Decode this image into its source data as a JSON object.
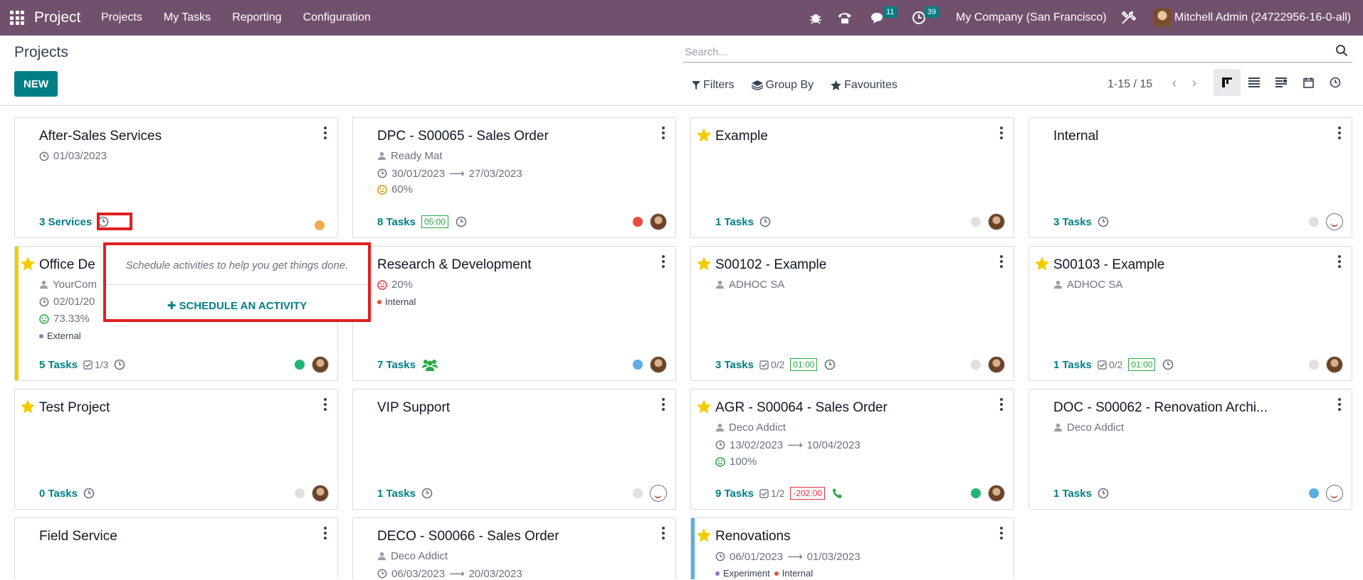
{
  "app": {
    "title": "Project"
  },
  "topnav": [
    "Projects",
    "My Tasks",
    "Reporting",
    "Configuration"
  ],
  "systray": {
    "messages_badge": "11",
    "activities_badge": "39",
    "company": "My Company (San Francisco)",
    "user": "Mitchell Admin (24722956-16-0-all)"
  },
  "control": {
    "title": "Projects",
    "new_label": "NEW",
    "search_placeholder": "Search...",
    "filters_label": "Filters",
    "groupby_label": "Group By",
    "favourites_label": "Favourites",
    "pager": "1-15 / 15"
  },
  "colors": {
    "topbar": "#71506d",
    "accent": "#017e84",
    "highlight": "#e02020",
    "star": "#f3cc00"
  },
  "popover": {
    "message": "Schedule activities to help you get things done.",
    "action": "SCHEDULE AN ACTIVITY"
  },
  "cards": [
    {
      "title": "After-Sales Services",
      "date": "01/03/2023",
      "footer_count": "3 Services"
    },
    {
      "title": "DPC - S00065 - Sales Order",
      "customer": "Ready Mat",
      "date_start": "30/01/2023",
      "date_end": "27/03/2023",
      "progress": "60%",
      "footer_count": "8 Tasks",
      "time": "05:00"
    },
    {
      "title": "Example",
      "footer_count": "1 Tasks"
    },
    {
      "title": "Internal",
      "footer_count": "3 Tasks"
    },
    {
      "title": "Office De",
      "customer": "YourCom",
      "date": "02/01/20",
      "progress": "73.33%",
      "tag": "External",
      "footer_count": "5 Tasks",
      "subtasks": "1/3"
    },
    {
      "title": "Research & Development",
      "progress": "20%",
      "tag": "Internal",
      "footer_count": "7 Tasks"
    },
    {
      "title": "S00102 - Example",
      "customer": "ADHOC SA",
      "footer_count": "3 Tasks",
      "subtasks": "0/2",
      "time": "01:00"
    },
    {
      "title": "S00103 - Example",
      "customer": "ADHOC SA",
      "footer_count": "1 Tasks",
      "subtasks": "0/2",
      "time": "01:00"
    },
    {
      "title": "Test Project",
      "footer_count": "0 Tasks"
    },
    {
      "title": "VIP Support",
      "footer_count": "1 Tasks"
    },
    {
      "title": "AGR - S00064 - Sales Order",
      "customer": "Deco Addict",
      "date_start": "13/02/2023",
      "date_end": "10/04/2023",
      "progress": "100%",
      "footer_count": "9 Tasks",
      "subtasks": "1/2",
      "time": "-202:00"
    },
    {
      "title": "DOC - S00062 - Renovation Archi...",
      "customer": "Deco Addict",
      "footer_count": "1 Tasks"
    },
    {
      "title": "Field Service"
    },
    {
      "title": "DECO - S00066 - Sales Order",
      "customer": "Deco Addict",
      "date_start": "06/03/2023",
      "date_end": "20/03/2023"
    },
    {
      "title": "Renovations",
      "date_start": "06/01/2023",
      "date_end": "01/03/2023",
      "tag1": "Experiment",
      "tag2": "Internal"
    }
  ]
}
